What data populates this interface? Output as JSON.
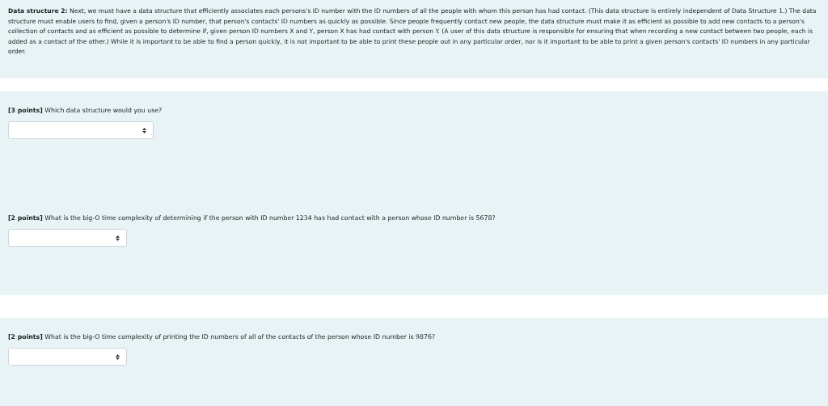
{
  "intro": "**Data structure 2:**  Next, we must have a data structure that efficiently associates each persons's ID number with the ID numbers of all the people with whom this person has had contact.  (This data structure is entirely independent of Data Structure 1.) The data structure must enable users to find, given a person's ID number, that person's contacts' ID numbers as quickly as possible.  Since people frequently contact new people, the data structure must make it as efficient as possible to add new contacts to a person's collection of contacts and as efficient as possible to determine if, given person ID numbers X and Y, person X has had contact with person Y. (A user of this data structure is responsible for ensuring that when recording a new contact between two people, each is added as a contact of the other.) While it is important to be able to find a person quickly, it is not important to be able to print these people out in any particular order, nor is it important to be able to print a given person's contacts' ID numbers in any particular order.",
  "sections": [
    {
      "questions": [
        {
          "prompt": "**[3 points]**  Which data structure would you use?"
        },
        {
          "prompt": "**[2 points]**  What is the big-O time complexity of determining if the person with ID number 1234 has had contact with a person whose ID number is 5678?"
        }
      ]
    },
    {
      "questions": [
        {
          "prompt": "**[2 points]** What is the big-O time complexity of printing the ID numbers of all of the contacts of the person whose ID number is 9876?"
        }
      ]
    }
  ]
}
